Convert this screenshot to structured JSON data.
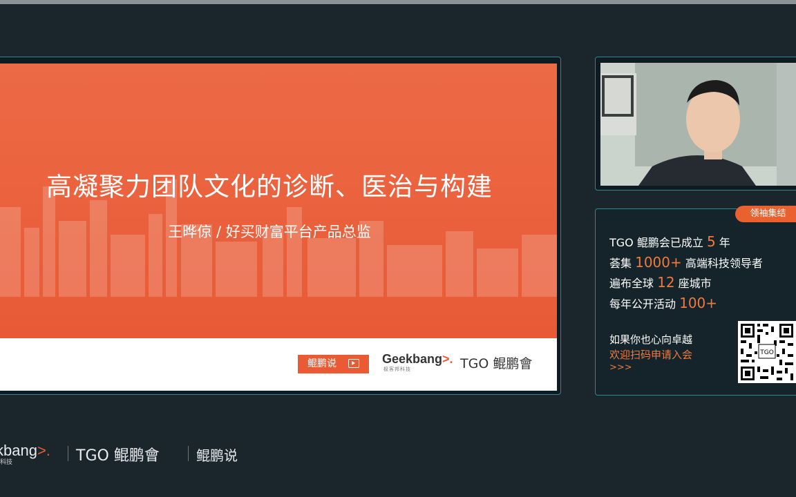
{
  "slide": {
    "title": "高凝聚力团队文化的诊断、医治与构建",
    "subtitle": "王晔倞 /  好买财富平台产品总监",
    "footer": {
      "badge_label": "鲲鹏说",
      "geek_text": "Geekbang",
      "geek_arrow": ">.",
      "geek_sub": "极客邦科技",
      "tgo_logo": "TGO 鲲鹏會"
    }
  },
  "info": {
    "tag": "领袖集结",
    "lines": [
      {
        "pre": "TGO 鲲鹏会已成立 ",
        "num": "5",
        "post": " 年"
      },
      {
        "pre": "荟集 ",
        "num": "1000+",
        "post": " 高端科技领导者"
      },
      {
        "pre": "遍布全球 ",
        "num": "12",
        "post": " 座城市"
      },
      {
        "pre": "每年公开活动 ",
        "num": "100+",
        "post": ""
      }
    ],
    "cta_line1": "如果你也心向卓越",
    "cta_line2": "欢迎扫码申请入会",
    "cta_arrows": ">>>",
    "qr_center_label": "TGO"
  },
  "bottom_logos": {
    "geek": "kbang",
    "geek_arrow": ">.",
    "geek_sub": "科技",
    "tgo": "TGO 鲲鹏會",
    "kps": "鲲鹏说"
  },
  "colors": {
    "slide_orange": "#ea603c",
    "accent_orange": "#f07a3c",
    "panel_border": "#2a8a95",
    "background": "#1b252c"
  },
  "icons": [
    "tv-icon",
    "qr-code-icon"
  ]
}
